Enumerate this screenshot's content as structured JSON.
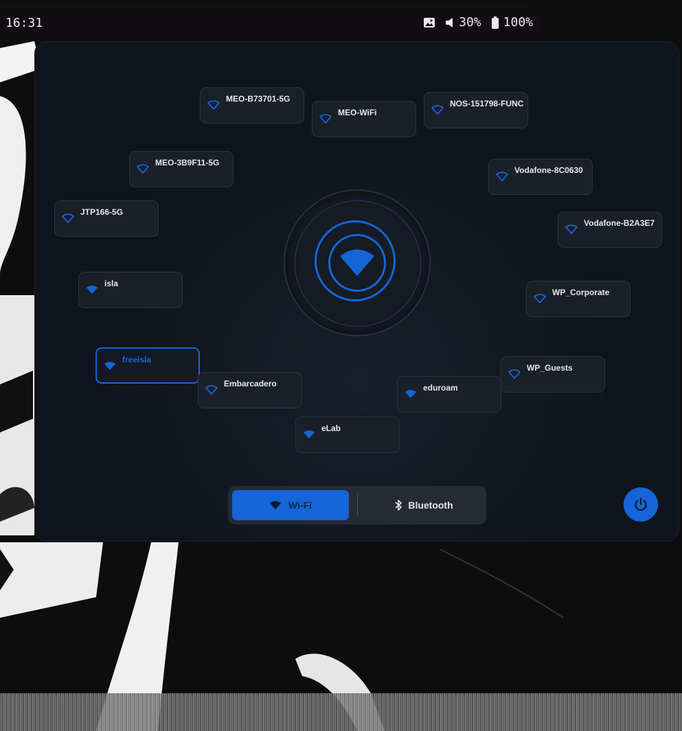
{
  "status_bar": {
    "clock": "16:31",
    "volume": "30%",
    "battery": "100%",
    "icons": [
      "image-icon",
      "volume-icon",
      "battery-icon"
    ]
  },
  "networks": [
    {
      "ssid": "MEO-B73701-5G",
      "active": false
    },
    {
      "ssid": "MEO-WiFi",
      "active": false
    },
    {
      "ssid": "NOS-151798-FUNC",
      "active": false
    },
    {
      "ssid": "MEO-3B9F11-5G",
      "active": false
    },
    {
      "ssid": "Vodafone-8C0630",
      "active": false
    },
    {
      "ssid": "JTP166-5G",
      "active": false
    },
    {
      "ssid": "Vodafone-B2A3E7",
      "active": false
    },
    {
      "ssid": "isla",
      "active": false
    },
    {
      "ssid": "WP_Corporate",
      "active": false
    },
    {
      "ssid": "freeisla",
      "active": true
    },
    {
      "ssid": "Embarcadero",
      "active": false
    },
    {
      "ssid": "WP_Guests",
      "active": false
    },
    {
      "ssid": "eduroam",
      "active": false
    },
    {
      "ssid": "eLab",
      "active": false
    }
  ],
  "switcher": {
    "wifi_label": "Wi-Fi",
    "bluetooth_label": "Bluetooth",
    "selected": "Wi-Fi"
  },
  "colors": {
    "accent": "#1565d8",
    "panel": "#0f141c",
    "card": "#1a1f28",
    "topbar": "#120d12"
  }
}
